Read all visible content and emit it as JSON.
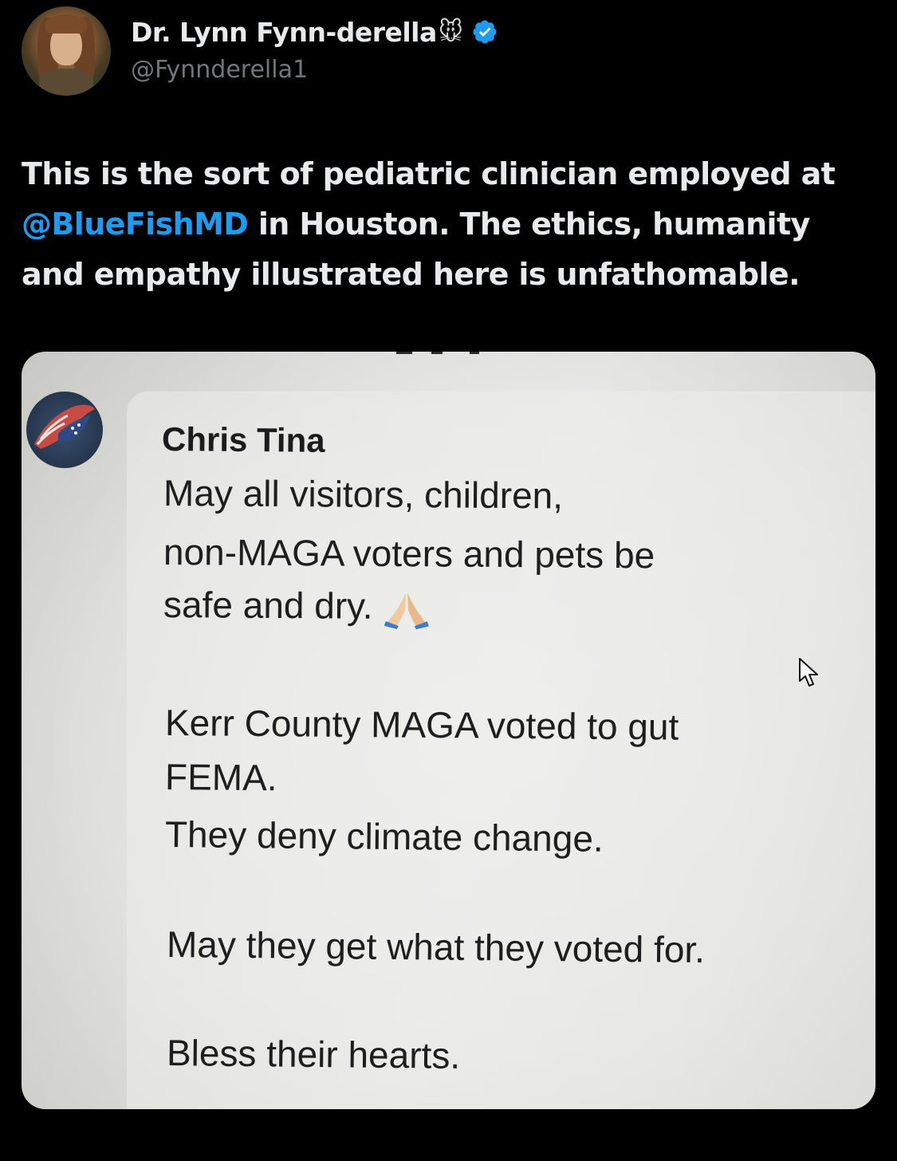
{
  "author": {
    "display_name": "Dr. Lynn Fynn-derella",
    "name_emoji": "🐭",
    "handle": "@Fynnderella1",
    "verified_icon": "verified-badge-icon",
    "accent_color": "#1d9bf0"
  },
  "tweet": {
    "text_before": "This is the sort of pediatric clinician employed at ",
    "mention": "@BlueFishMD",
    "text_after": " in Houston. The ethics, humanity and empathy illustrated here is unfathomable."
  },
  "media": {
    "post_author": "Chris Tina",
    "lines": [
      "May all visitors, children,",
      "non-MAGA voters and pets be",
      "safe and dry.",
      "Kerr County MAGA voted to gut",
      "FEMA.",
      "They deny climate change.",
      "May they get what they voted for.",
      "Bless their hearts."
    ],
    "pray_emoji_icon": "praying-hands-icon",
    "cursor_icon": "mouse-cursor-icon"
  }
}
